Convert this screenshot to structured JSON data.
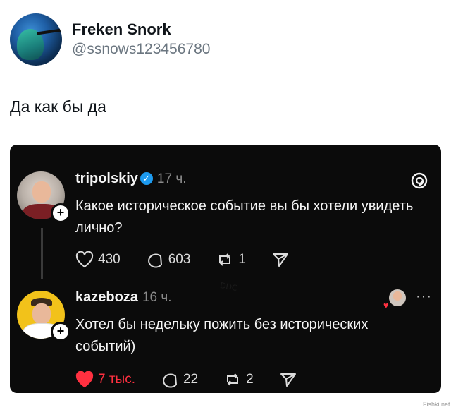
{
  "tweet": {
    "author_name": "Freken Snork",
    "author_handle": "@ssnows123456780",
    "text": "Да как бы да"
  },
  "threads_card": {
    "post1": {
      "username": "tripolskiy",
      "verified": true,
      "time": "17 ч.",
      "text": "Какое историческое событие вы бы хотели увидеть лично?",
      "likes": "430",
      "replies": "603",
      "reposts": "1"
    },
    "watermark": "DDC",
    "post2": {
      "username": "kazeboza",
      "time": "16 ч.",
      "text": "Хотел бы недельку пожить без исторических событий)",
      "likes": "7 тыс.",
      "replies": "22",
      "reposts": "2",
      "more": "···"
    }
  },
  "site_mark": "Fishki.net",
  "colors": {
    "card_bg": "#0b0b0b",
    "like_red": "#ff3040",
    "verified_blue": "#1d9bf0"
  }
}
